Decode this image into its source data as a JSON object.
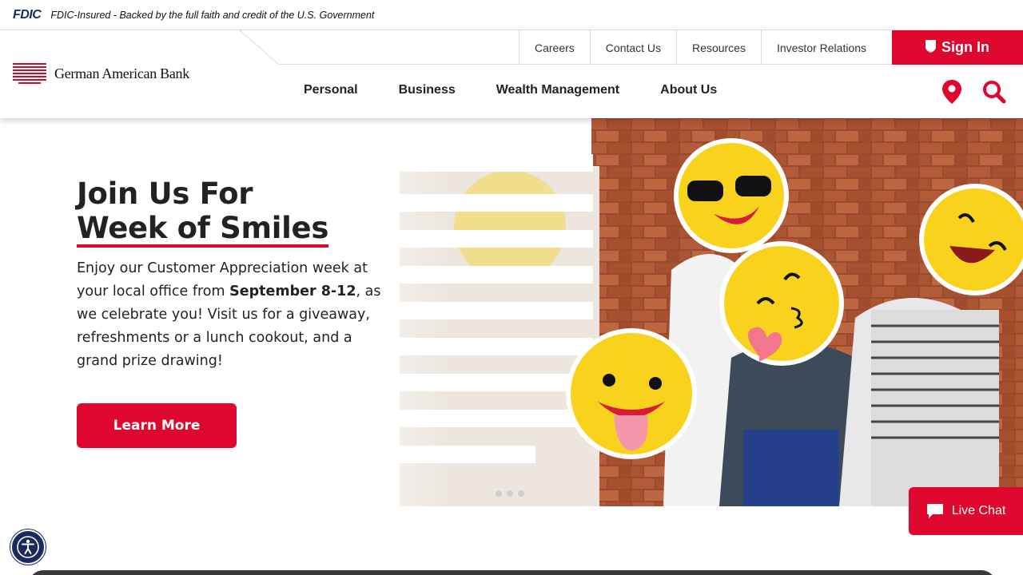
{
  "fdic": {
    "logo": "FDIC",
    "text": "FDIC-Insured - Backed by the full faith and credit of the U.S. Government"
  },
  "brand": {
    "name": "German American Bank",
    "accent": "#e0072f",
    "navy": "#1a2a5c"
  },
  "util_nav": [
    "Careers",
    "Contact Us",
    "Resources",
    "Investor Relations"
  ],
  "signin": {
    "label": "Sign In",
    "icon": "shield-icon"
  },
  "main_nav": [
    "Personal",
    "Business",
    "Wealth Management",
    "About Us"
  ],
  "header_icons": [
    "location-pin-icon",
    "search-icon"
  ],
  "hero": {
    "title_line1": "Join Us For",
    "title_line2": "Week of Smiles",
    "body_pre": "Enjoy our Customer Appreciation week at your local office from ",
    "body_bold": "September 8-12",
    "body_post": ", as we celebrate you! Visit us for a giveaway, refreshments or a lunch cookout, and a grand prize drawing!",
    "cta": "Learn More",
    "slides": 3
  },
  "live_chat": {
    "label": "Live Chat",
    "icon": "chat-bubble-icon"
  },
  "accessibility": {
    "icon": "accessibility-icon"
  }
}
